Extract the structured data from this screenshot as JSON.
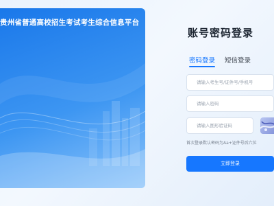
{
  "banner": {
    "title": "贵州省普通高校招生考试考生综合信息平台"
  },
  "login": {
    "title": "账号密码登录",
    "tabs": [
      {
        "label": "密码登录",
        "active": true
      },
      {
        "label": "短信登录",
        "active": false
      }
    ],
    "fields": {
      "account_placeholder": "请输入考生号/证件号/手机号",
      "password_placeholder": "请输入密码",
      "captcha_placeholder": "请输入图形验证码"
    },
    "hint": "首次登录默认密码为Aa+证件号后六位",
    "submit_label": "立即登录"
  },
  "colors": {
    "accent": "#1677ff",
    "banner_blue": "#1a78ea"
  }
}
